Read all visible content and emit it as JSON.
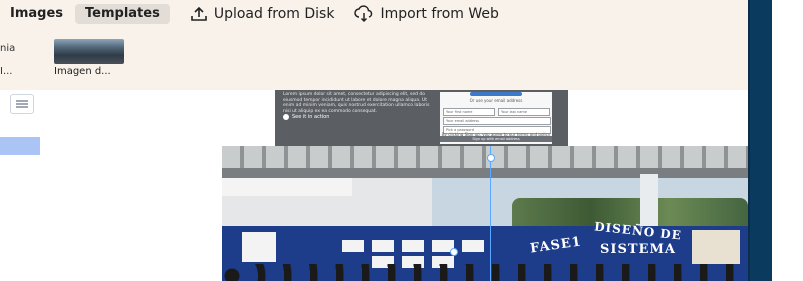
{
  "tabs": [
    {
      "label": "Images"
    },
    {
      "label": "Templates"
    }
  ],
  "actions": {
    "upload": "Upload from Disk",
    "import": "Import from Web"
  },
  "assets": [
    {
      "caption_partial_top": "nia",
      "caption_partial_bottom": "I..."
    },
    {
      "caption": "Imagen d..."
    }
  ],
  "slide": {
    "body_text": "Lorem ipsum dolor sit amet, consectetur adipiscing elit, sed do eiusmod tempor incididunt ut labore et dolore magna aliqua. Ut enim ad minim veniam, quis nostrud exercitation ullamco laboris nisi ut aliquip ex ea commodo consequat.",
    "cta": "See it in action",
    "form_title": "Or use your email address",
    "fields": [
      "Your first name",
      "Your last name",
      "Your email address",
      "Pick a password"
    ],
    "fine_print": "By clicking Sign up, you agree to our terms and policy",
    "submit": "Sign up with email address"
  },
  "photo": {
    "board_text_1": "FASE1",
    "board_text_2": "DISEÑO DE",
    "board_text_3": "SISTEMA"
  },
  "colors": {
    "panel_bg": "#f8f2ea",
    "right_strip": "#0b3a5f",
    "selection": "#a9c4f5",
    "guide": "#5aa8ff"
  }
}
